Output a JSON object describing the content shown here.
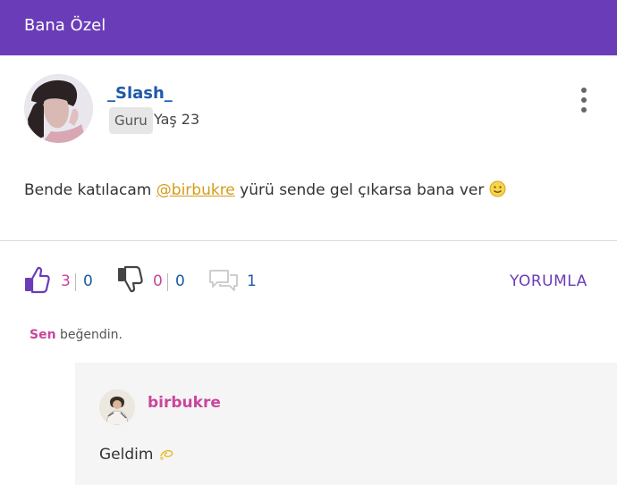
{
  "header": {
    "title": "Bana Özel"
  },
  "post": {
    "author": "_Slash_",
    "badge": "Guru",
    "age": "Yaş 23",
    "text_before": "Bende katılacam ",
    "mention": "@birbukre",
    "text_after": " yürü sende gel çıkarsa bana ver",
    "emoji_icon": "smiley-icon"
  },
  "actions": {
    "like_count": "3",
    "like_count_other": "0",
    "dislike_count": "0",
    "dislike_count_other": "0",
    "comment_count": "1",
    "comment_label": "YORUMLA"
  },
  "liked_by": {
    "you": "Sen",
    "text": "beğendin."
  },
  "reply": {
    "author": "birbukre",
    "text": "Geldim",
    "emoji_icon": "dizzy-icon"
  },
  "colors": {
    "header_bg": "#6a3cb8",
    "accent_purple": "#6a3cb8",
    "username_blue": "#1e5aa8",
    "pink": "#c9469d",
    "mention_orange": "#d69a1a"
  }
}
